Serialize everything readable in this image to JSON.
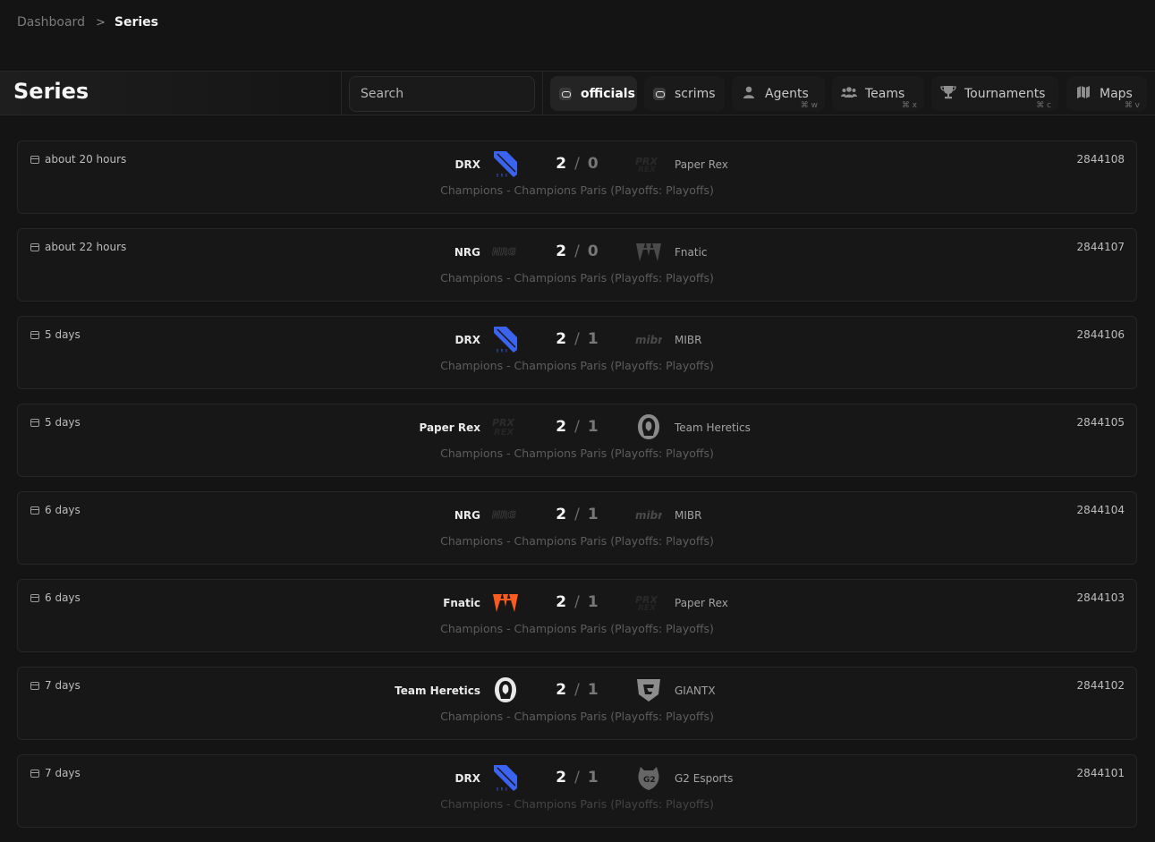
{
  "breadcrumb": {
    "parent": "Dashboard",
    "separator": ">",
    "current": "Series"
  },
  "header": {
    "title": "Series"
  },
  "search": {
    "placeholder": "Search"
  },
  "tabs": [
    {
      "label": "officials",
      "icon": "officials-icon",
      "shortcut": ""
    },
    {
      "label": "scrims",
      "icon": "scrims-icon",
      "shortcut": ""
    },
    {
      "label": "Agents",
      "icon": "user-icon",
      "shortcut": "⌘ w"
    },
    {
      "label": "Teams",
      "icon": "users-icon",
      "shortcut": "⌘ x"
    },
    {
      "label": "Tournaments",
      "icon": "trophy-icon",
      "shortcut": "⌘ c"
    },
    {
      "label": "Maps",
      "icon": "map-icon",
      "shortcut": "⌘ v"
    }
  ],
  "series": [
    {
      "time": "about 20 hours",
      "team_a": "DRX",
      "logo_a": "drx",
      "score_a": "2",
      "score_b": "0",
      "team_b": "Paper Rex",
      "logo_b": "prx-dim",
      "event": "Champions - Champions Paris (Playoffs: Playoffs)",
      "id": "2844108"
    },
    {
      "time": "about 22 hours",
      "team_a": "NRG",
      "logo_a": "nrg",
      "score_a": "2",
      "score_b": "0",
      "team_b": "Fnatic",
      "logo_b": "fnatic-dim",
      "event": "Champions - Champions Paris (Playoffs: Playoffs)",
      "id": "2844107"
    },
    {
      "time": "5 days",
      "team_a": "DRX",
      "logo_a": "drx",
      "score_a": "2",
      "score_b": "1",
      "team_b": "MIBR",
      "logo_b": "mibr",
      "event": "Champions - Champions Paris (Playoffs: Playoffs)",
      "id": "2844106"
    },
    {
      "time": "5 days",
      "team_a": "Paper Rex",
      "logo_a": "prx",
      "score_a": "2",
      "score_b": "1",
      "team_b": "Team Heretics",
      "logo_b": "heretics-dim",
      "event": "Champions - Champions Paris (Playoffs: Playoffs)",
      "id": "2844105"
    },
    {
      "time": "6 days",
      "team_a": "NRG",
      "logo_a": "nrg",
      "score_a": "2",
      "score_b": "1",
      "team_b": "MIBR",
      "logo_b": "mibr",
      "event": "Champions - Champions Paris (Playoffs: Playoffs)",
      "id": "2844104"
    },
    {
      "time": "6 days",
      "team_a": "Fnatic",
      "logo_a": "fnatic",
      "score_a": "2",
      "score_b": "1",
      "team_b": "Paper Rex",
      "logo_b": "prx-dim",
      "event": "Champions - Champions Paris (Playoffs: Playoffs)",
      "id": "2844103"
    },
    {
      "time": "7 days",
      "team_a": "Team Heretics",
      "logo_a": "heretics",
      "score_a": "2",
      "score_b": "1",
      "team_b": "GIANTX",
      "logo_b": "giantx",
      "event": "Champions - Champions Paris (Playoffs: Playoffs)",
      "id": "2844102"
    },
    {
      "time": "7 days",
      "team_a": "DRX",
      "logo_a": "drx",
      "score_a": "2",
      "score_b": "1",
      "team_b": "G2 Esports",
      "logo_b": "g2",
      "event": "Champions - Champions Paris (Playoffs: Playoffs)",
      "id": "2844101"
    }
  ],
  "colors": {
    "background": "#141414",
    "drx": "#3b63f0",
    "fnatic": "#ff5a1f"
  }
}
